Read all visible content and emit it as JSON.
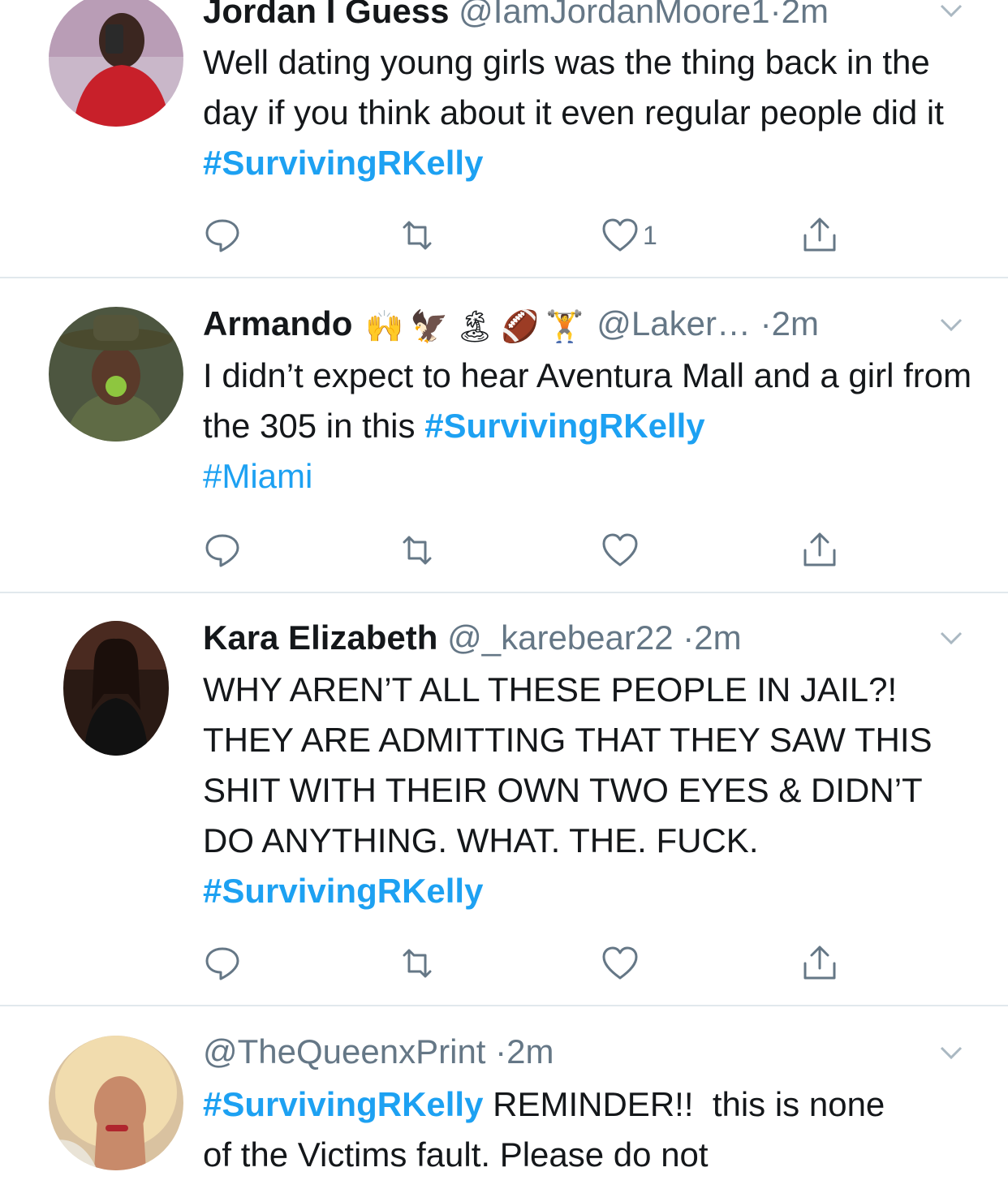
{
  "colors": {
    "hashtag": "#1da1f2",
    "secondary_text": "#657786",
    "divider": "#e1e8ed",
    "primary_text": "#14171a"
  },
  "tweets": [
    {
      "name": "Jordan I Guess",
      "handle": "@IamJordanMoore1",
      "dot": "·",
      "time": "2m",
      "text_parts": [
        "Well dating young girls was the thing back in the day if you think about it even regular people did it "
      ],
      "hashtags": [
        "#SurvivingRKelly"
      ],
      "actions": {
        "reply_icon": "reply-icon",
        "retweet_icon": "retweet-icon",
        "like_icon": "heart-icon",
        "like_count": "1",
        "share_icon": "share-icon"
      }
    },
    {
      "name": "Armando",
      "emojis": [
        "🙌",
        "🦅",
        "🏝",
        "🏈",
        "🏋"
      ],
      "handle": "@Laker…",
      "dot": "·",
      "time": "2m",
      "text_parts": [
        "I didn’t expect to hear Aventura Mall and a girl from the 305 in this "
      ],
      "hashtags": [
        "#SurvivingRKelly",
        "#Miami"
      ],
      "actions": {
        "reply_icon": "reply-icon",
        "retweet_icon": "retweet-icon",
        "like_icon": "heart-icon",
        "like_count": "",
        "share_icon": "share-icon"
      }
    },
    {
      "name": "Kara Elizabeth",
      "handle": "@_karebear22",
      "dot": "·",
      "time": "2m",
      "text_parts": [
        "WHY AREN’T ALL THESE PEOPLE IN JAIL?! THEY ARE ADMITTING THAT THEY SAW THIS SHIT WITH THEIR OWN TWO EYES & DIDN’T DO ANYTHING. WHAT. THE. FUCK. "
      ],
      "hashtags": [
        "#SurvivingRKelly"
      ],
      "actions": {
        "reply_icon": "reply-icon",
        "retweet_icon": "retweet-icon",
        "like_icon": "heart-icon",
        "like_count": "",
        "share_icon": "share-icon"
      }
    },
    {
      "name": "",
      "handle": "@TheQueenxPrint",
      "dot": "·",
      "time": "2m",
      "text_parts": [
        " REMINDER!!  this is none of the Victims fault. Please do not"
      ],
      "hashtags": [
        "#SurvivingRKelly"
      ]
    }
  ]
}
